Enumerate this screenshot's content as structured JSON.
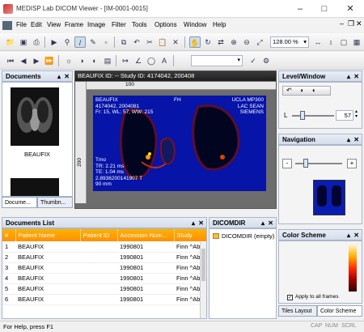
{
  "window": {
    "title": "MEDISP Lab DICOM Viewer - [IM-0001-0015]"
  },
  "menu": [
    "File",
    "Edit",
    "View",
    "Frame",
    "Image",
    "Filter",
    "Tools",
    "Options",
    "Window",
    "Help"
  ],
  "toolbar": {
    "zoom": "128.00 %"
  },
  "documents_panel": {
    "title": "Documents",
    "thumb_label": "BEAUFIX",
    "tabs": [
      "Docume...",
      "Thumbn..."
    ]
  },
  "viewer": {
    "title": "BEAUFIX ID: -- Study ID: 4174042, 200408",
    "ruler_label": "100",
    "side_ruler_label": "200",
    "overlay_tl": [
      "BEAUFIX",
      "4174042, 2004081",
      "Fr: 15, WL: 57, WW: 215"
    ],
    "overlay_tr": [
      "UCLA MP300",
      "LAC SEAN",
      "SIEMENS"
    ],
    "overlay_bl": [
      "Tmo",
      "TR: 2.21 ms",
      "TE: 1.04 ms",
      "2.8936200141907 T",
      "90 mm"
    ],
    "overlay_top": "FH"
  },
  "level_window": {
    "title": "Level/Window",
    "label": "L",
    "value": "57"
  },
  "navigation": {
    "title": "Navigation",
    "minus": "-",
    "plus": "+"
  },
  "color_scheme": {
    "title": "Color Scheme",
    "apply_all": "Apply to all frames"
  },
  "right_tabs": [
    "Tiles Layout",
    "Color Scheme"
  ],
  "documents_list": {
    "title": "Documents List",
    "columns": [
      "#",
      "Patient Name",
      "Patient ID",
      "Accession Num...",
      "Study"
    ],
    "rows": [
      [
        "1",
        "BEAUFIX",
        "",
        "1990801",
        "Finn ^Ab"
      ],
      [
        "2",
        "BEAUFIX",
        "",
        "1990801",
        "Finn ^Ab"
      ],
      [
        "3",
        "BEAUFIX",
        "",
        "1990801",
        "Finn ^Ab"
      ],
      [
        "4",
        "BEAUFIX",
        "",
        "1990801",
        "Finn ^Ab"
      ],
      [
        "5",
        "BEAUFIX",
        "",
        "1990801",
        "Finn ^Ab"
      ],
      [
        "6",
        "BEAUFIX",
        "",
        "1990801",
        "Finn ^Ab"
      ]
    ]
  },
  "dicomdir": {
    "title": "DICOMDIR",
    "root": "DICOMDIR (empty)"
  },
  "status": {
    "text": "For Help, press F1",
    "indicators": [
      "CAP",
      "NUM",
      "SCRL"
    ]
  }
}
